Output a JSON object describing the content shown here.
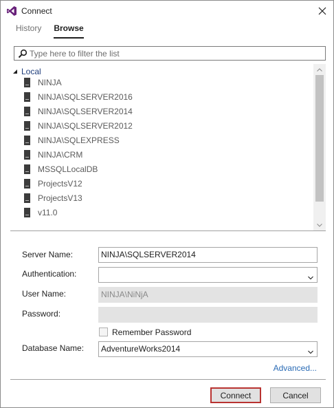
{
  "window": {
    "title": "Connect",
    "icon": "visual-studio-icon",
    "accent_color": "#68217a"
  },
  "tabs": [
    {
      "label": "History",
      "active": false
    },
    {
      "label": "Browse",
      "active": true
    }
  ],
  "filter": {
    "placeholder": "Type here to filter the list",
    "value": ""
  },
  "tree": {
    "group_label": "Local",
    "expanded": true,
    "servers": [
      {
        "label": "NINJA"
      },
      {
        "label": "NINJA\\SQLSERVER2016"
      },
      {
        "label": "NINJA\\SQLSERVER2014"
      },
      {
        "label": "NINJA\\SQLSERVER2012"
      },
      {
        "label": "NINJA\\SQLEXPRESS"
      },
      {
        "label": "NINJA\\CRM"
      },
      {
        "label": "MSSQLLocalDB"
      },
      {
        "label": "ProjectsV12"
      },
      {
        "label": "ProjectsV13"
      },
      {
        "label": "v11.0"
      }
    ]
  },
  "form": {
    "server_name_label": "Server Name:",
    "server_name_value": "NINJA\\SQLSERVER2014",
    "authentication_label": "Authentication:",
    "authentication_value": "",
    "user_name_label": "User Name:",
    "user_name_value": "NINJA\\NiNjA",
    "password_label": "Password:",
    "password_value": "",
    "remember_password_label": "Remember Password",
    "remember_password_checked": false,
    "database_name_label": "Database Name:",
    "database_name_value": "AdventureWorks2014",
    "advanced_label": "Advanced..."
  },
  "buttons": {
    "connect_label": "Connect",
    "cancel_label": "Cancel"
  }
}
